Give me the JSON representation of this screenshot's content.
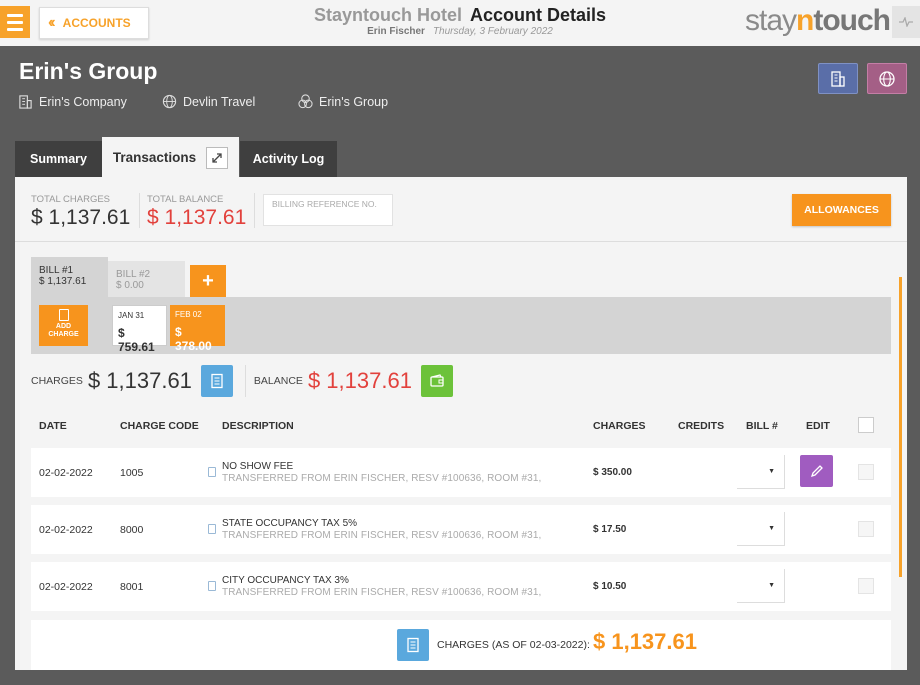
{
  "header": {
    "accounts_label": "ACCOUNTS",
    "hotel_name": "Stayntouch Hotel",
    "page_title": "Account Details",
    "user_name": "Erin Fischer",
    "date": "Thursday, 3 February 2022",
    "logo_stay": "stay",
    "logo_n": "n",
    "logo_touch": "touch"
  },
  "group": {
    "name": "Erin's Group",
    "company": "Erin's Company",
    "travel_agent": "Devlin Travel",
    "group": "Erin's Group"
  },
  "tabs": [
    {
      "label": "Summary"
    },
    {
      "label": "Transactions"
    },
    {
      "label": "Activity Log"
    }
  ],
  "summary": {
    "total_charges_label": "TOTAL CHARGES",
    "total_charges": "$ 1,137.61",
    "total_balance_label": "TOTAL BALANCE",
    "total_balance": "$ 1,137.61",
    "billing_ref_placeholder": "BILLING REFERENCE NO.",
    "allowances_label": "ALLOWANCES"
  },
  "bills": [
    {
      "label": "BILL #1",
      "amount": "$ 1,137.61"
    },
    {
      "label": "BILL #2",
      "amount": "$ 0.00"
    }
  ],
  "add_bill_label": "+",
  "add_charge_label_1": "ADD",
  "add_charge_label_2": "CHARGE",
  "date_cards": [
    {
      "date": "JAN 31",
      "amount": "$ 759.61"
    },
    {
      "date": "FEB 02",
      "amount": "$ 378.00"
    }
  ],
  "totals": {
    "charges_label": "CHARGES",
    "charges": "$ 1,137.61",
    "balance_label": "BALANCE",
    "balance": "$ 1,137.61"
  },
  "table": {
    "columns": [
      "DATE",
      "CHARGE CODE",
      "DESCRIPTION",
      "CHARGES",
      "CREDITS",
      "BILL #",
      "EDIT"
    ],
    "rows": [
      {
        "date": "02-02-2022",
        "code": "1005",
        "desc": "NO SHOW FEE",
        "sub": "TRANSFERRED FROM ERIN FISCHER, RESV #100636, ROOM #31,",
        "charges": "$ 350.00"
      },
      {
        "date": "02-02-2022",
        "code": "8000",
        "desc": "STATE OCCUPANCY TAX 5%",
        "sub": "TRANSFERRED FROM ERIN FISCHER, RESV #100636, ROOM #31,",
        "charges": "$ 17.50"
      },
      {
        "date": "02-02-2022",
        "code": "8001",
        "desc": "CITY OCCUPANCY TAX 3%",
        "sub": "TRANSFERRED FROM ERIN FISCHER, RESV #100636, ROOM #31,",
        "charges": "$ 10.50"
      }
    ]
  },
  "footer": {
    "label": "CHARGES (AS OF 02-03-2022):",
    "value": "$ 1,137.61"
  },
  "colors": {
    "accent": "#f7941d",
    "red": "#e2413c",
    "purple": "#a05cc0",
    "green": "#6cc23a",
    "blue": "#5aa8dd"
  }
}
